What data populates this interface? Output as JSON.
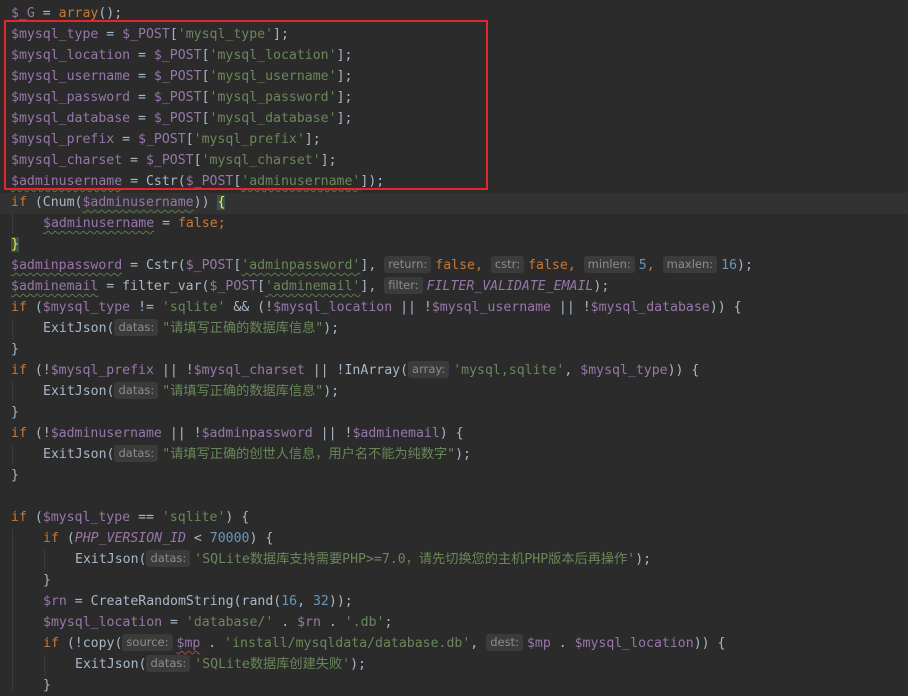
{
  "code": {
    "l0": {
      "a": "$_G",
      "b": " = ",
      "c": "array",
      "d": "();"
    },
    "l1": {
      "a": "$mysql_type",
      "b": " = ",
      "c": "$_POST",
      "d": "[",
      "e": "'mysql_type'",
      "f": "];"
    },
    "l2": {
      "a": "$mysql_location",
      "b": " = ",
      "c": "$_POST",
      "d": "[",
      "e": "'mysql_location'",
      "f": "];"
    },
    "l3": {
      "a": "$mysql_username",
      "b": " = ",
      "c": "$_POST",
      "d": "[",
      "e": "'mysql_username'",
      "f": "];"
    },
    "l4": {
      "a": "$mysql_password",
      "b": " = ",
      "c": "$_POST",
      "d": "[",
      "e": "'mysql_password'",
      "f": "];"
    },
    "l5": {
      "a": "$mysql_database",
      "b": " = ",
      "c": "$_POST",
      "d": "[",
      "e": "'mysql_database'",
      "f": "];"
    },
    "l6": {
      "a": "$mysql_prefix",
      "b": " = ",
      "c": "$_POST",
      "d": "[",
      "e": "'mysql_prefix'",
      "f": "];"
    },
    "l7": {
      "a": "$mysql_charset",
      "b": " = ",
      "c": "$_POST",
      "d": "[",
      "e": "'mysql_charset'",
      "f": "];"
    },
    "l8": {
      "a": "$adminusername",
      "b": " = Cstr(",
      "c": "$_POST",
      "d": "[",
      "e": "'adminusername'",
      "f": "]);"
    },
    "l9": {
      "a": "if",
      "b": " (Cnum(",
      "c": "$adminusername",
      "d": ")) ",
      "e": "{"
    },
    "l10": {
      "a": "$adminusername",
      "b": " = ",
      "c": "false",
      "d": ";"
    },
    "l11": {
      "a": "}"
    },
    "l12": {
      "a": "$adminpassword",
      "b": " = Cstr(",
      "c": "$_POST",
      "d": "[",
      "e": "'adminpassword'",
      "f": "], ",
      "h1": "return:",
      "g": "false",
      "h": ", ",
      "h2": "cstr:",
      "i": "false",
      "j": ", ",
      "h3": "minlen:",
      "k": "5",
      "l": ", ",
      "h4": "maxlen:",
      "m": "16",
      "n": ");"
    },
    "l13": {
      "a": "$adminemail",
      "b": " = filter_var(",
      "c": "$_POST",
      "d": "[",
      "e": "'adminemail'",
      "f": "], ",
      "h1": "filter:",
      "g": "FILTER_VALIDATE_EMAIL",
      "h": ");"
    },
    "l14": {
      "a": "if",
      "b": " (",
      "c": "$mysql_type",
      "d": " != ",
      "e": "'sqlite'",
      "f": " && (!",
      "g": "$mysql_location",
      "h": " || !",
      "i": "$mysql_username",
      "j": " || !",
      "k": "$mysql_database",
      "l": ")) {"
    },
    "l15": {
      "a": "ExitJson(",
      "h1": "datas:",
      "b": "\"请填写正确的数据库信息\"",
      "c": ");"
    },
    "l16": {
      "a": "}"
    },
    "l17": {
      "a": "if",
      "b": " (!",
      "c": "$mysql_prefix",
      "d": " || !",
      "e": "$mysql_charset",
      "f": " || !InArray(",
      "h1": "array:",
      "g": "'mysql,sqlite'",
      "h": ", ",
      "i": "$mysql_type",
      "j": ")) {"
    },
    "l18": {
      "a": "ExitJson(",
      "h1": "datas:",
      "b": "\"请填写正确的数据库信息\"",
      "c": ");"
    },
    "l19": {
      "a": "}"
    },
    "l20": {
      "a": "if",
      "b": " (!",
      "c": "$adminusername",
      "d": " || !",
      "e": "$adminpassword",
      "f": " || !",
      "g": "$adminemail",
      "h": ") {"
    },
    "l21": {
      "a": "ExitJson(",
      "h1": "datas:",
      "b": "\"请填写正确的创世人信息，用户名不能为纯数字\"",
      "c": ");"
    },
    "l22": {
      "a": "}"
    },
    "l24": {
      "a": "if",
      "b": " (",
      "c": "$mysql_type",
      "d": " == ",
      "e": "'sqlite'",
      "f": ") {"
    },
    "l25": {
      "a": "if",
      "b": " (",
      "c": "PHP_VERSION_ID",
      "d": " < ",
      "e": "70000",
      "f": ") {"
    },
    "l26": {
      "a": "ExitJson(",
      "h1": "datas:",
      "b": "'SQLite数据库支持需要PHP>=7.0，请先切换您的主机PHP版本后再操作'",
      "c": ");"
    },
    "l27": {
      "a": "}"
    },
    "l28": {
      "a": "$rn",
      "b": " = CreateRandomString(rand(",
      "c": "16",
      "d": ", ",
      "e": "32",
      "f": "));"
    },
    "l29": {
      "a": "$mysql_location",
      "b": " = ",
      "c": "'database/'",
      "d": " . ",
      "e": "$rn",
      "f": " . ",
      "g": "'.db'",
      "h": ";"
    },
    "l30": {
      "a": "if",
      "b": " (!copy(",
      "h1": "source:",
      "c": "$mp",
      "d": " . ",
      "e": "'install/mysqldata/database.db'",
      "f": ", ",
      "h2": "dest:",
      "g": "$mp",
      "h": " . ",
      "i": "$mysql_location",
      "j": ")) {"
    },
    "l31": {
      "a": "ExitJson(",
      "h1": "datas:",
      "b": "'SQLite数据库创建失败'",
      "c": ");"
    },
    "l32": {
      "a": "}"
    }
  },
  "colors": {
    "background": "#2b2b2b",
    "highlight_box": "#e5252a"
  }
}
